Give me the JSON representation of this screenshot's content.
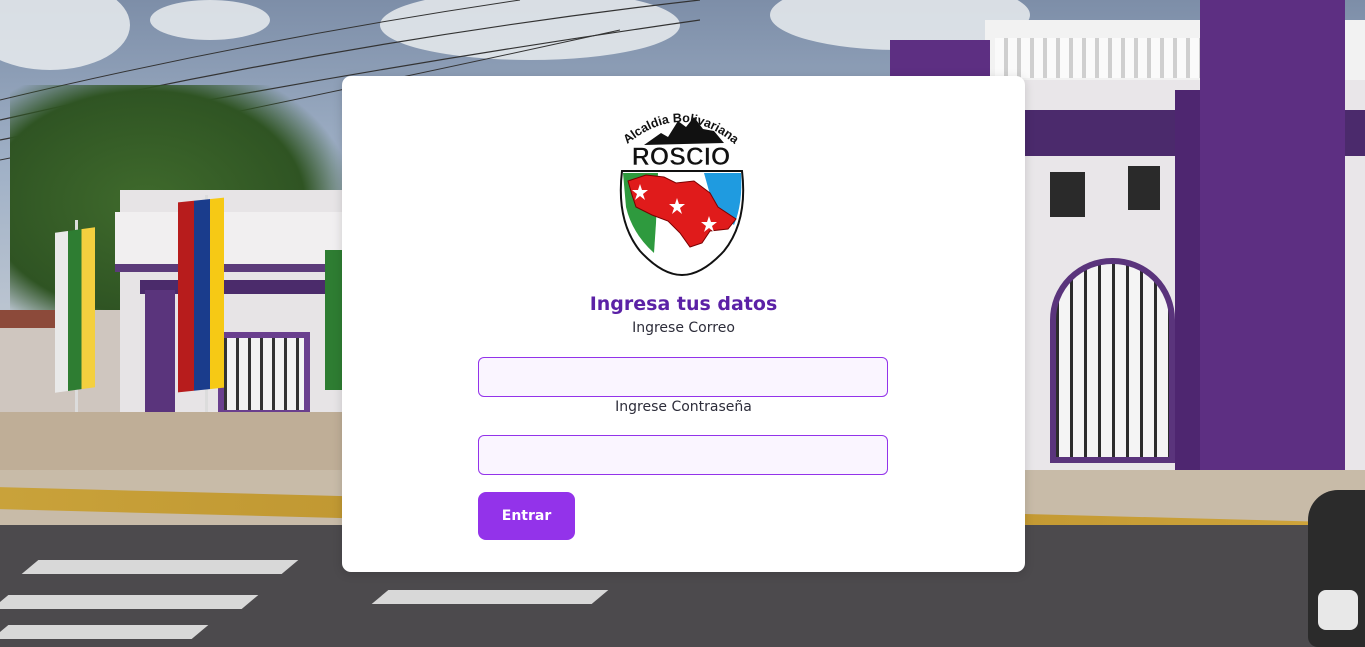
{
  "logo": {
    "arc_text": "Alcaldia Bolivariana",
    "name": "ROSCIO",
    "colors": {
      "green": "#2e9a3e",
      "red": "#e01b1b",
      "blue": "#1f9be0",
      "outline": "#111111"
    }
  },
  "form": {
    "title": "Ingresa tus datos",
    "email_label": "Ingrese Correo",
    "email_value": "",
    "password_label": "Ingrese Contraseña",
    "password_value": "",
    "submit_label": "Entrar"
  },
  "colors": {
    "accent": "#9333ea",
    "title": "#5b21a6",
    "field_bg": "#faf5ff",
    "card_bg": "#ffffff"
  }
}
